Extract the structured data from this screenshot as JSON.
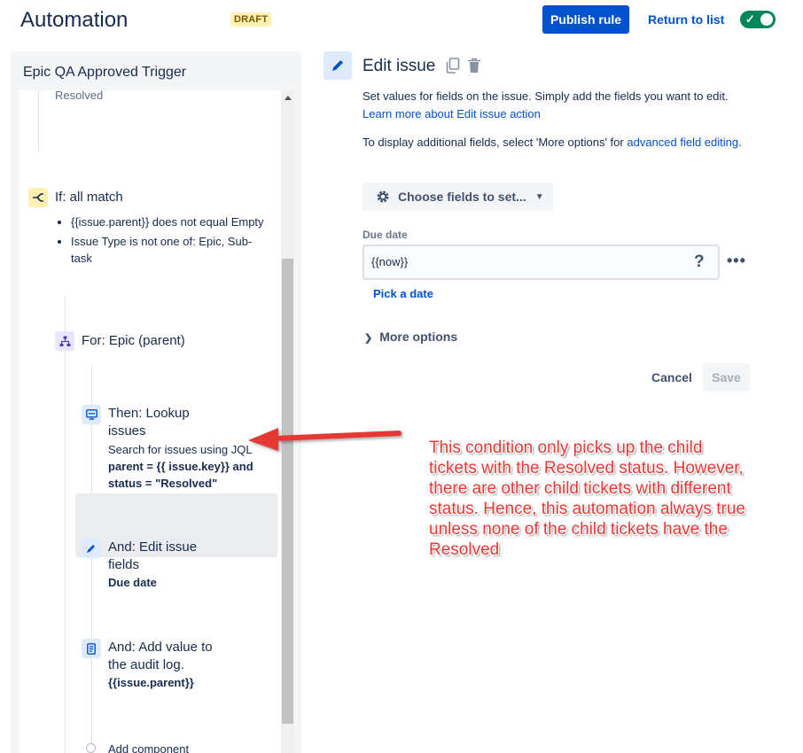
{
  "header": {
    "title": "Automation",
    "badge": "DRAFT",
    "publish_label": "Publish rule",
    "return_label": "Return to list",
    "enabled": true
  },
  "rule": {
    "name": "Epic QA Approved Trigger",
    "truncated_top": "Resolved",
    "condition": {
      "title": "If: all match",
      "items": [
        "{{issue.parent}} does not equal Empty",
        "Issue Type is not one of: Epic, Sub-task"
      ]
    },
    "branch": {
      "title": "For: Epic (parent)"
    },
    "lookup": {
      "title_l1": "Then: Lookup",
      "title_l2": "issues",
      "desc": "Search for issues using JQL",
      "jql_l1": "parent = {{ issue.key}} and",
      "jql_l2": "status = \"Resolved\""
    },
    "edit": {
      "title_l1": "And: Edit issue",
      "title_l2": "fields",
      "field": "Due date"
    },
    "log": {
      "title_l1": "And: Add value to",
      "title_l2": "the audit log.",
      "value": "{{issue.parent}}"
    },
    "add_component": "Add component"
  },
  "editor": {
    "title": "Edit issue",
    "desc_text": "Set values for fields on the issue. Simply add the fields you want to edit.",
    "desc_link": "Learn more about Edit issue action",
    "extra_text": "To display additional fields, select 'More options' for",
    "extra_link": "advanced field editing",
    "extra_end": ".",
    "choose_label": "Choose fields to set...",
    "field_label": "Due date",
    "field_value": "{{now}}",
    "help": "?",
    "pick_date": "Pick a date",
    "more_options": "More options",
    "cancel": "Cancel",
    "save": "Save"
  },
  "annotation": {
    "text": "This condition only picks up the child tickets with the Resolved status. However, there are other child tickets with different status. Hence, this automation always true unless none of the child tickets have the Resolved"
  },
  "colors": {
    "primary": "#0052cc",
    "toggle_on": "#00875a",
    "annotation": "#e53935",
    "condition_icon_bg": "#fff0b3",
    "branch_icon_bg": "#eae6ff",
    "action_icon_bg": "#deebff"
  }
}
